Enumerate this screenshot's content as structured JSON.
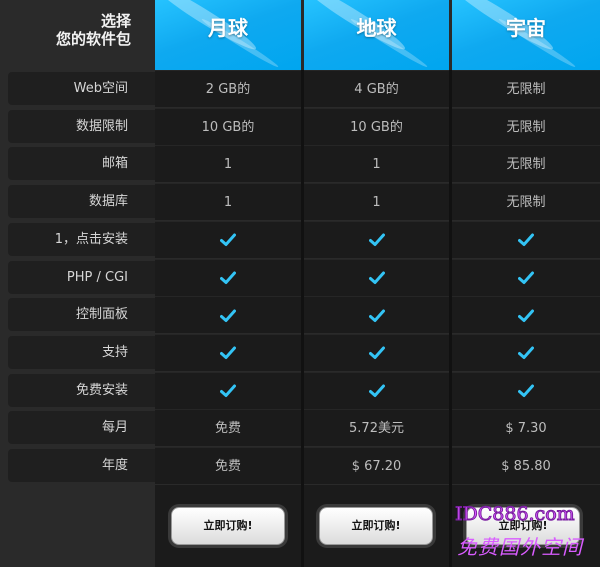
{
  "header": {
    "choose_line1": "选择",
    "choose_line2": "您的软件包",
    "plans": [
      "月球",
      "地球",
      "宇宙"
    ]
  },
  "rows": [
    {
      "label": "Web空间",
      "values": [
        "2 GB的",
        "4 GB的",
        "无限制"
      ]
    },
    {
      "label": "数据限制",
      "values": [
        "10 GB的",
        "10 GB的",
        "无限制"
      ]
    },
    {
      "label": "邮箱",
      "values": [
        "1",
        "1",
        "无限制"
      ]
    },
    {
      "label": "数据库",
      "values": [
        "1",
        "1",
        "无限制"
      ]
    },
    {
      "label": "1，点击安装",
      "values": [
        "check",
        "check",
        "check"
      ]
    },
    {
      "label": "PHP / CGI",
      "values": [
        "check",
        "check",
        "check"
      ]
    },
    {
      "label": "控制面板",
      "values": [
        "check",
        "check",
        "check"
      ]
    },
    {
      "label": "支持",
      "values": [
        "check",
        "check",
        "check"
      ]
    },
    {
      "label": "免费安装",
      "values": [
        "check",
        "check",
        "check"
      ]
    },
    {
      "label": "每月",
      "values": [
        "免费",
        "5.72美元",
        "$ 7.30"
      ]
    },
    {
      "label": "年度",
      "values": [
        "免费",
        "$ 67.20",
        "$ 85.80"
      ]
    }
  ],
  "footer": {
    "buttons": [
      "立即订购!",
      "立即订购!",
      "立即订购!"
    ]
  },
  "watermark": {
    "line1": "IDC886.com",
    "line2": "免费国外空间"
  },
  "colors": {
    "accent": "#00a6ef",
    "check": "#33c4f5",
    "watermark": "#d95cff"
  }
}
